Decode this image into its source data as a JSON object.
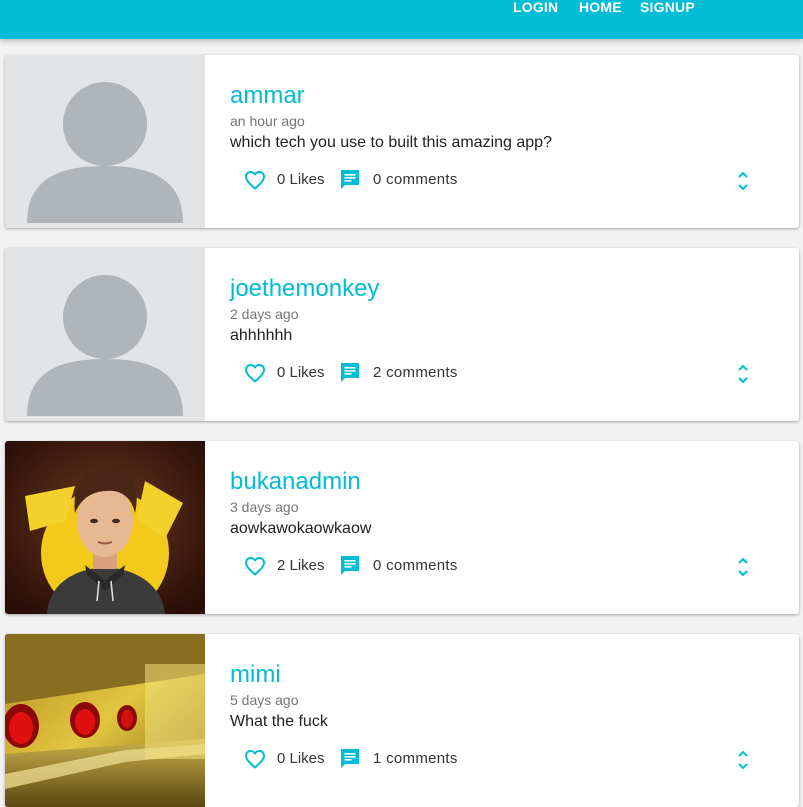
{
  "nav": {
    "login": "LOGIN",
    "home": "HOME",
    "signup": "SIGNUP"
  },
  "colors": {
    "accent": "#00bcd4",
    "placeholder_bg": "#e3e4e6",
    "placeholder_figure": "#b0b5b9"
  },
  "posts": [
    {
      "username": "ammar",
      "time": "an hour ago",
      "body": "which tech you use to built this amazing app?",
      "likes": "0 Likes",
      "comments": "0 comments",
      "avatar": "default-profile-icon"
    },
    {
      "username": "joethemonkey",
      "time": "2 days ago",
      "body": "ahhhhhh",
      "likes": "0 Likes",
      "comments": "2 comments",
      "avatar": "default-profile-icon"
    },
    {
      "username": "bukanadmin",
      "time": "3 days ago",
      "body": "aowkawokaowkaow",
      "likes": "2 Likes",
      "comments": "0 comments",
      "avatar": "illustrated-portrait-photo"
    },
    {
      "username": "mimi",
      "time": "5 days ago",
      "body": "What the fuck",
      "likes": "0 Likes",
      "comments": "1 comments",
      "avatar": "yellow-room-photo"
    }
  ]
}
